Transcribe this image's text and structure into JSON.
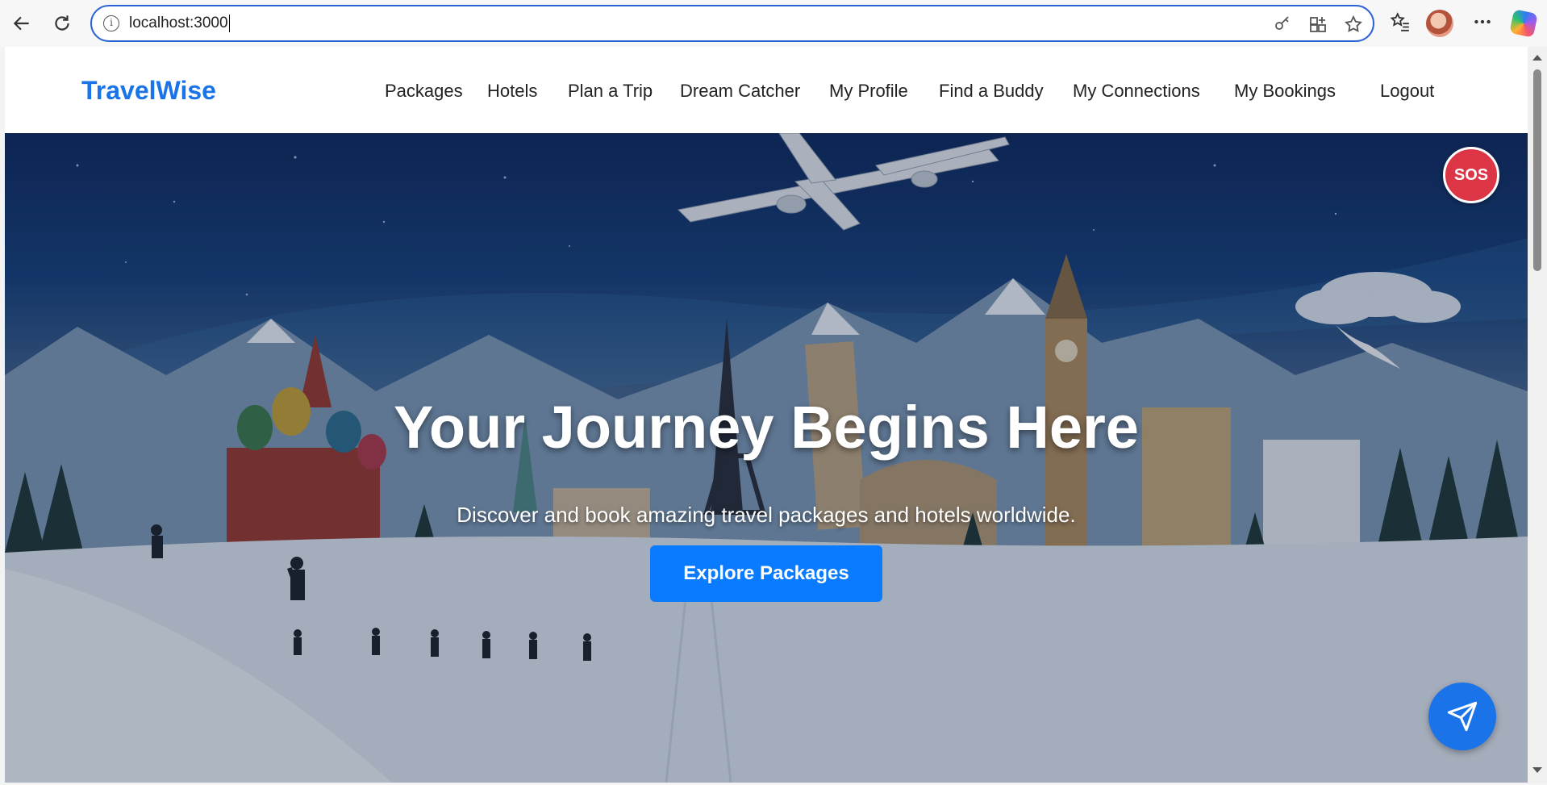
{
  "browser": {
    "url": "localhost:3000"
  },
  "app": {
    "brand": "TravelWise",
    "nav": [
      "Packages",
      "Hotels",
      "Plan a Trip",
      "Dream Catcher",
      "My Profile",
      "Find a Buddy",
      "My Connections",
      "My Bookings",
      "Logout"
    ]
  },
  "hero": {
    "title": "Your Journey Begins Here",
    "subtitle": "Discover and book amazing travel packages and hotels worldwide.",
    "cta_label": "Explore Packages",
    "sos_label": "SOS"
  },
  "colors": {
    "accent": "#1a73e8",
    "button": "#0a7bff",
    "sos": "#dc3545"
  }
}
